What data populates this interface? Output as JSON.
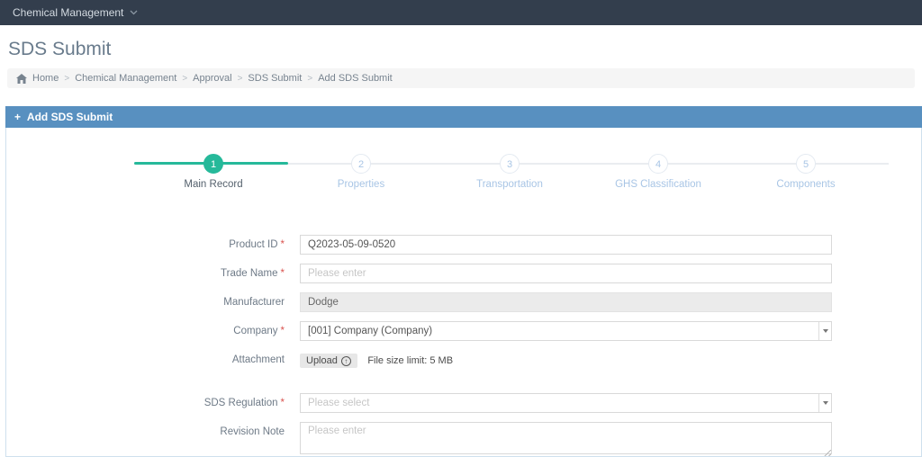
{
  "navbar": {
    "menu_label": "Chemical Management"
  },
  "page": {
    "title": "SDS Submit"
  },
  "breadcrumb": {
    "separator": ">",
    "items": [
      "Home",
      "Chemical Management",
      "Approval",
      "SDS Submit",
      "Add SDS Submit"
    ]
  },
  "panel": {
    "plus": "+",
    "title": "Add SDS Submit"
  },
  "stepper": {
    "steps": [
      {
        "num": "1",
        "label": "Main Record",
        "active": true
      },
      {
        "num": "2",
        "label": "Properties",
        "active": false
      },
      {
        "num": "3",
        "label": "Transportation",
        "active": false
      },
      {
        "num": "4",
        "label": "GHS Classification",
        "active": false
      },
      {
        "num": "5",
        "label": "Components",
        "active": false
      }
    ]
  },
  "form": {
    "product_id": {
      "label": "Product ID",
      "required": "*",
      "value": "Q2023-05-09-0520"
    },
    "trade_name": {
      "label": "Trade Name",
      "required": "*",
      "placeholder": "Please enter"
    },
    "manufacturer": {
      "label": "Manufacturer",
      "value": "Dodge"
    },
    "company": {
      "label": "Company",
      "required": "*",
      "value": "[001] Company (Company)"
    },
    "attachment": {
      "label": "Attachment",
      "button_label": "Upload",
      "hint": "File size limit: 5 MB"
    },
    "sds_regulation": {
      "label": "SDS Regulation",
      "required": "*",
      "placeholder": "Please select"
    },
    "revision_note": {
      "label": "Revision Note",
      "placeholder": "Please enter"
    }
  },
  "colors": {
    "navbar_bg": "#333e4d",
    "panel_header_bg": "#5890c0",
    "active_step_teal": "#26b99a",
    "inactive_step_text": "#a8c5e5",
    "required_asterisk": "#d9534f",
    "breadcrumb_bg": "#f5f5f5"
  }
}
